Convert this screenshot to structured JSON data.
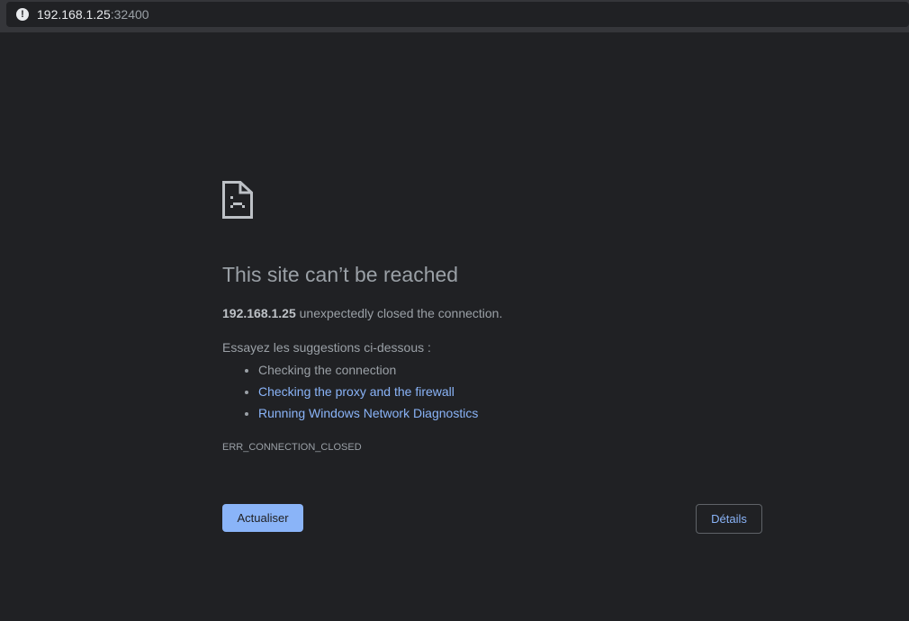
{
  "address_bar": {
    "host": "192.168.1.25",
    "port": ":32400",
    "icon": "info-icon"
  },
  "error": {
    "icon": "sad-document-icon",
    "title": "This site can’t be reached",
    "host": "192.168.1.25",
    "message": " unexpectedly closed the connection.",
    "suggestions_heading": "Essayez les suggestions ci-dessous :",
    "suggestions": [
      "Checking the connection",
      "Checking the proxy and the firewall",
      "Running Windows Network Diagnostics"
    ],
    "code": "ERR_CONNECTION_CLOSED"
  },
  "buttons": {
    "reload": "Actualiser",
    "details": "Détails"
  },
  "colors": {
    "background": "#202124",
    "link": "#8ab4f8",
    "text": "#9aa0a6"
  }
}
